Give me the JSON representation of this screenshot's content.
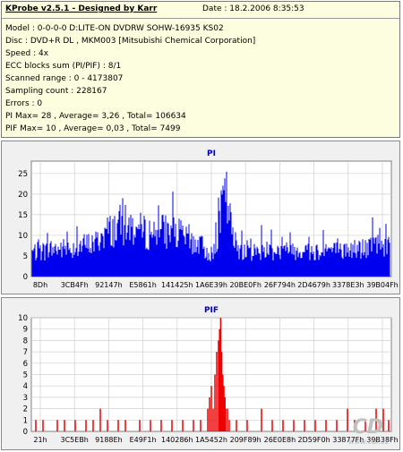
{
  "header": {
    "title": "KProbe v2.5.1 - Designed by Karr",
    "date": "Date : 18.2.2006 8:35:53",
    "lines": [
      "Model : 0-0-0-0 D:LITE-ON DVDRW SOHW-16935 KS02",
      "Disc : DVD+R DL , MKM003 [Mitsubishi Chemical Corporation]",
      "Speed : 4x",
      "ECC blocks sum (PI/PIF) : 8/1",
      "Scanned range : 0 - 4173807",
      "Sampling count : 228167",
      "Errors : 0",
      "PI Max= 28 , Average= 3,26 , Total= 106634",
      "PIF Max= 10 , Average= 0,03 , Total= 7499"
    ]
  },
  "watermark": {
    "text": "CD",
    "subtext": "www.cdr.cz"
  },
  "colors": {
    "pi": "#0000ee",
    "pif": "#ee0000",
    "title": "#0000cc",
    "plot_bg": "#ffffff",
    "panel_bg": "#f0f0f0"
  },
  "chart_data": [
    {
      "type": "bar",
      "title": "PI",
      "ylim": [
        0,
        28
      ],
      "yticks": [
        0,
        5,
        10,
        15,
        20,
        25
      ],
      "xtick_labels": [
        "8Dh",
        "3CB4Fh",
        "92147h",
        "E5861h",
        "141425h",
        "1A6E39h",
        "20BE0Fh",
        "26F794h",
        "2D4679h",
        "3378E3h",
        "39B04Fh"
      ],
      "grid": true,
      "profile": [
        [
          0.0,
          8
        ],
        [
          0.02,
          8
        ],
        [
          0.06,
          9
        ],
        [
          0.1,
          9
        ],
        [
          0.14,
          10
        ],
        [
          0.18,
          11
        ],
        [
          0.2,
          14
        ],
        [
          0.22,
          15
        ],
        [
          0.25,
          17
        ],
        [
          0.28,
          16
        ],
        [
          0.32,
          14
        ],
        [
          0.36,
          15
        ],
        [
          0.4,
          14
        ],
        [
          0.44,
          12
        ],
        [
          0.47,
          10
        ],
        [
          0.49,
          8
        ],
        [
          0.51,
          7
        ],
        [
          0.52,
          15
        ],
        [
          0.53,
          22
        ],
        [
          0.54,
          27
        ],
        [
          0.55,
          20
        ],
        [
          0.56,
          12
        ],
        [
          0.58,
          9
        ],
        [
          0.62,
          8
        ],
        [
          0.66,
          9
        ],
        [
          0.7,
          8
        ],
        [
          0.74,
          9
        ],
        [
          0.78,
          8
        ],
        [
          0.82,
          9
        ],
        [
          0.86,
          8
        ],
        [
          0.9,
          9
        ],
        [
          0.94,
          9
        ],
        [
          0.97,
          12
        ],
        [
          1.0,
          9
        ]
      ]
    },
    {
      "type": "bar",
      "title": "PIF",
      "ylim": [
        0,
        10
      ],
      "yticks": [
        0,
        1,
        2,
        3,
        4,
        5,
        6,
        7,
        8,
        9,
        10
      ],
      "xtick_labels": [
        "21h",
        "3C5EBh",
        "9188Eh",
        "E49F1h",
        "140286h",
        "1A5452h",
        "209F89h",
        "26E0E8h",
        "2D59F0h",
        "33877Fh",
        "39B38Fh"
      ],
      "grid": true,
      "spikes": [
        [
          0.01,
          1
        ],
        [
          0.03,
          1
        ],
        [
          0.07,
          1
        ],
        [
          0.09,
          1
        ],
        [
          0.12,
          1
        ],
        [
          0.15,
          1
        ],
        [
          0.17,
          1
        ],
        [
          0.19,
          2
        ],
        [
          0.21,
          1
        ],
        [
          0.24,
          1
        ],
        [
          0.26,
          1
        ],
        [
          0.3,
          1
        ],
        [
          0.33,
          1
        ],
        [
          0.36,
          1
        ],
        [
          0.39,
          1
        ],
        [
          0.42,
          1
        ],
        [
          0.45,
          1
        ],
        [
          0.47,
          1
        ],
        [
          0.49,
          2
        ],
        [
          0.495,
          3
        ],
        [
          0.5,
          4
        ],
        [
          0.505,
          2
        ],
        [
          0.51,
          5
        ],
        [
          0.515,
          7
        ],
        [
          0.52,
          8
        ],
        [
          0.523,
          9
        ],
        [
          0.526,
          10
        ],
        [
          0.529,
          7
        ],
        [
          0.532,
          5
        ],
        [
          0.535,
          4
        ],
        [
          0.538,
          3
        ],
        [
          0.54,
          2
        ],
        [
          0.545,
          2
        ],
        [
          0.55,
          1
        ],
        [
          0.57,
          1
        ],
        [
          0.6,
          1
        ],
        [
          0.64,
          2
        ],
        [
          0.67,
          1
        ],
        [
          0.7,
          1
        ],
        [
          0.73,
          1
        ],
        [
          0.76,
          1
        ],
        [
          0.79,
          1
        ],
        [
          0.82,
          1
        ],
        [
          0.85,
          1
        ],
        [
          0.88,
          2
        ],
        [
          0.9,
          1
        ],
        [
          0.93,
          1
        ],
        [
          0.96,
          2
        ],
        [
          0.98,
          2
        ],
        [
          0.995,
          1
        ]
      ]
    }
  ]
}
